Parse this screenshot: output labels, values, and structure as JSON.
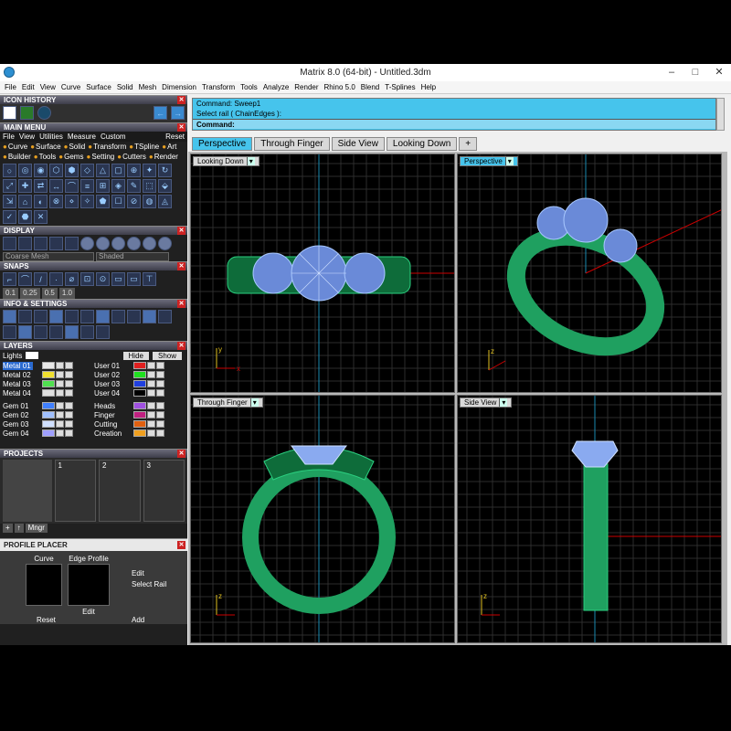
{
  "window": {
    "title": "Matrix 8.0 (64-bit) - Untitled.3dm"
  },
  "menu": [
    "File",
    "Edit",
    "View",
    "Curve",
    "Surface",
    "Solid",
    "Mesh",
    "Dimension",
    "Transform",
    "Tools",
    "Analyze",
    "Render",
    "Rhino 5.0",
    "Blend",
    "T-Splines",
    "Help"
  ],
  "panels": {
    "icon_history": "ICON HISTORY",
    "main_menu": "MAIN MENU",
    "display": "DISPLAY",
    "snaps": "SNAPS",
    "info_settings": "INFO & SETTINGS",
    "layers": "LAYERS",
    "projects": "PROJECTS",
    "profile_placer": "PROFILE PLACER"
  },
  "main_menu": {
    "menu": [
      "File",
      "View",
      "Utilities",
      "Measure",
      "Custom"
    ],
    "reset": "Reset",
    "cats1": [
      "Curve",
      "Surface",
      "Solid",
      "Transform",
      "TSpline",
      "Art"
    ],
    "cats2": [
      "Builder",
      "Tools",
      "Gems",
      "Setting",
      "Cutters",
      "Render"
    ]
  },
  "display": {
    "mesh": "Coarse Mesh",
    "shade": "Shaded"
  },
  "snaps": {
    "vals": [
      "0.1",
      "0.25",
      "0.5",
      "1.0"
    ]
  },
  "layers": {
    "lights": "Lights",
    "hide": "Hide",
    "show": "Show",
    "left": [
      {
        "name": "Metal 01",
        "color": "#e8e8e8"
      },
      {
        "name": "Metal 02",
        "color": "#f0e030"
      },
      {
        "name": "Metal 03",
        "color": "#50e050"
      },
      {
        "name": "Metal 04",
        "color": "#e0e0e0"
      },
      {
        "name": "Gem 01",
        "color": "#4080ff"
      },
      {
        "name": "Gem 02",
        "color": "#a0c0ff"
      },
      {
        "name": "Gem 03",
        "color": "#d0e0ff"
      },
      {
        "name": "Gem 04",
        "color": "#a0a0ff"
      }
    ],
    "right": [
      {
        "name": "User 01",
        "color": "#e02020"
      },
      {
        "name": "User 02",
        "color": "#20e020"
      },
      {
        "name": "User 03",
        "color": "#2040e0"
      },
      {
        "name": "User 04",
        "color": "#000000"
      },
      {
        "name": "Heads",
        "color": "#a050e0"
      },
      {
        "name": "Finger",
        "color": "#c02080"
      },
      {
        "name": "Cutting",
        "color": "#e06010"
      },
      {
        "name": "Creation",
        "color": "#f0a020"
      }
    ]
  },
  "projects": {
    "slots": [
      "1",
      "2",
      "3"
    ],
    "mngr": "Mngr"
  },
  "profile_placer": {
    "curve": "Curve",
    "edge_profile": "Edge Profile",
    "edit_btn": "Edit",
    "edit": "Edit",
    "select_rail": "Select Rail",
    "reset": "Reset",
    "add": "Add"
  },
  "command": {
    "line1": "Command: Sweep1",
    "line2": "Select rail ( ChainEdges ):",
    "line3": "Command:"
  },
  "tabs": [
    "Perspective",
    "Through Finger",
    "Side View",
    "Looking Down"
  ],
  "viewports": {
    "top_left": "Looking Down",
    "top_right": "Perspective",
    "bottom_left": "Through Finger",
    "bottom_right": "Side View"
  },
  "colors": {
    "accent": "#46c4ec",
    "metal": "#1fa060",
    "gem": "#a8c8ff",
    "grid": "#3a3a3a"
  }
}
